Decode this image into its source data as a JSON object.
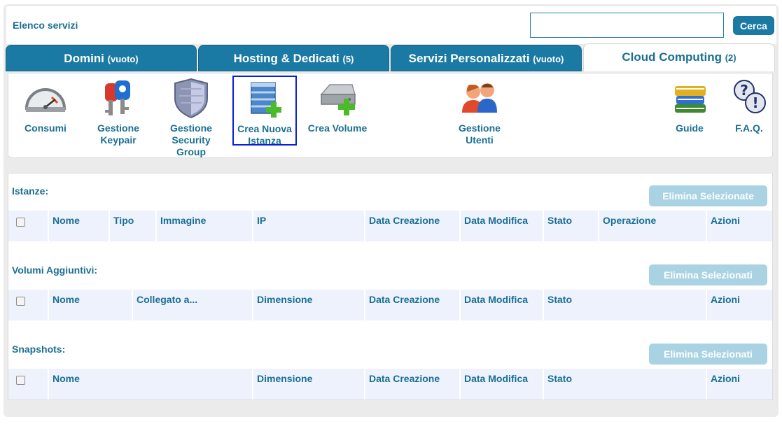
{
  "header": {
    "section_title": "Elenco servizi",
    "search_placeholder": "",
    "search_button": "Cerca"
  },
  "tabs": [
    {
      "label": "Domini",
      "count": "(vuoto)",
      "active": false
    },
    {
      "label": "Hosting & Dedicati",
      "count": "(5)",
      "active": false
    },
    {
      "label": "Servizi Personalizzati",
      "count": "(vuoto)",
      "active": false
    },
    {
      "label": "Cloud Computing",
      "count": "(2)",
      "active": true
    }
  ],
  "tools": [
    {
      "label": "Consumi",
      "icon": "gauge-icon"
    },
    {
      "label": "Gestione Keypair",
      "icon": "keys-icon"
    },
    {
      "label": "Gestione Security Group",
      "icon": "shield-icon"
    },
    {
      "label": "Crea Nuova Istanza",
      "icon": "server-add-icon",
      "selected": true
    },
    {
      "label": "Crea Volume",
      "icon": "disk-add-icon"
    },
    {
      "label": "Gestione Utenti",
      "icon": "users-icon"
    },
    {
      "label": "Guide",
      "icon": "books-icon"
    },
    {
      "label": "F.A.Q.",
      "icon": "faq-icon"
    }
  ],
  "sections": {
    "istanze": {
      "label": "Istanze:",
      "delete_button": "Elimina Selezionate",
      "columns": [
        "Nome",
        "Tipo",
        "Immagine",
        "IP",
        "Data Creazione",
        "Data Modifica",
        "Stato",
        "Operazione",
        "Azioni"
      ]
    },
    "volumi": {
      "label": "Volumi Aggiuntivi:",
      "delete_button": "Elimina Selezionati",
      "columns": [
        "Nome",
        "Collegato a...",
        "Dimensione",
        "Data Creazione",
        "Data Modifica",
        "Stato",
        "Azioni"
      ]
    },
    "snapshots": {
      "label": "Snapshots:",
      "delete_button": "Elimina Selezionati",
      "columns": [
        "Nome",
        "Dimensione",
        "Data Creazione",
        "Data Modifica",
        "Stato",
        "Azioni"
      ]
    }
  },
  "colors": {
    "primary": "#1b7aa3",
    "text": "#1b6f93",
    "header_bg": "#edf2fd",
    "disabled_button": "#a9d3e3",
    "selected_outline": "#0a1fd6"
  }
}
